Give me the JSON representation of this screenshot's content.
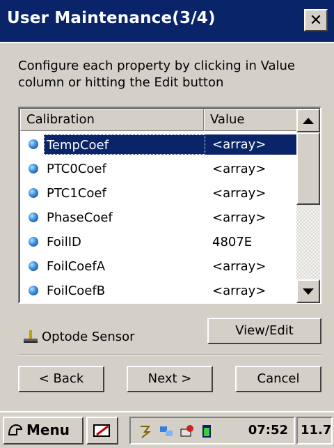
{
  "window": {
    "title": "User Maintenance(3/4)",
    "close_label": "✕"
  },
  "instructions": "Configure each property by clicking in Value column or hitting the Edit button",
  "list": {
    "columns": [
      "Calibration",
      "Value"
    ],
    "rows": [
      {
        "name": "TempCoef",
        "value": "<array>",
        "selected": true
      },
      {
        "name": "PTC0Coef",
        "value": "<array>"
      },
      {
        "name": "PTC1Coef",
        "value": "<array>"
      },
      {
        "name": "PhaseCoef",
        "value": "<array>"
      },
      {
        "name": "FoilID",
        "value": "4807E"
      },
      {
        "name": "FoilCoefA",
        "value": "<array>"
      },
      {
        "name": "FoilCoefB",
        "value": "<array>"
      }
    ]
  },
  "sensor_label": "Optode Sensor",
  "buttons": {
    "view_edit": "View/Edit",
    "back": "< Back",
    "next": "Next >",
    "cancel": "Cancel"
  },
  "taskbar": {
    "start_label": "Menu",
    "clock": "07:52",
    "extra": "11.7"
  },
  "colors": {
    "titlebar": "#0a246a",
    "selection": "#0a246a",
    "face": "#d4d0c8"
  }
}
